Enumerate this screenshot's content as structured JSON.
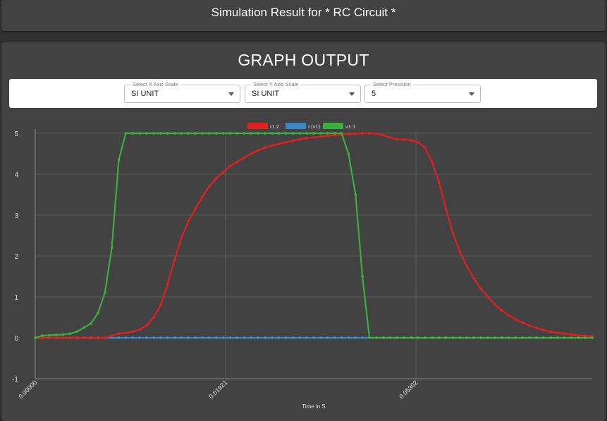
{
  "header": {
    "title": "Simulation Result for * RC Circuit *"
  },
  "graph": {
    "heading": "GRAPH OUTPUT",
    "controls": [
      {
        "label": "Select X Axis Scale",
        "value": "SI UNIT"
      },
      {
        "label": "Select Y Axis Scale",
        "value": "SI UNIT"
      },
      {
        "label": "Select Precision",
        "value": "5"
      }
    ]
  },
  "chart_data": {
    "type": "line",
    "xlabel": "Time in S",
    "ylabel": "",
    "x_tick_labels": [
      "0.00000",
      "0.01921",
      "0.05302"
    ],
    "y_ticks": [
      -1,
      0,
      1,
      2,
      3,
      4,
      5
    ],
    "ylim": [
      -1,
      5
    ],
    "legend_position": "top-center",
    "grid": true,
    "series": [
      {
        "name": "r1.2",
        "color": "#e02020",
        "values": [
          0,
          0,
          0,
          0,
          0,
          0,
          0,
          0,
          0,
          0,
          0,
          0.05,
          0.1,
          0.12,
          0.15,
          0.2,
          0.3,
          0.5,
          0.8,
          1.3,
          1.9,
          2.45,
          2.85,
          3.15,
          3.45,
          3.7,
          3.9,
          4.05,
          4.2,
          4.3,
          4.4,
          4.5,
          4.58,
          4.65,
          4.7,
          4.74,
          4.78,
          4.82,
          4.85,
          4.88,
          4.9,
          4.92,
          4.94,
          4.95,
          4.97,
          4.98,
          4.99,
          5.0,
          5.0,
          4.99,
          4.95,
          4.9,
          4.85,
          4.85,
          4.83,
          4.78,
          4.65,
          4.3,
          3.8,
          3.15,
          2.55,
          2.1,
          1.75,
          1.45,
          1.2,
          1.0,
          0.82,
          0.67,
          0.55,
          0.45,
          0.37,
          0.3,
          0.24,
          0.19,
          0.15,
          0.12,
          0.1,
          0.08,
          0.06,
          0.05,
          0.04
        ]
      },
      {
        "name": "I (v1)",
        "color": "#3d86c6",
        "values": [
          0,
          0,
          0,
          0,
          0,
          0,
          0,
          0,
          0,
          0,
          0,
          0,
          0,
          0,
          0,
          0,
          0,
          0,
          0,
          0,
          0,
          0,
          0,
          0,
          0,
          0,
          0,
          0,
          0,
          0,
          0,
          0,
          0,
          0,
          0,
          0,
          0,
          0,
          0,
          0,
          0,
          0,
          0,
          0,
          0,
          0,
          0,
          0,
          0,
          0,
          0,
          0,
          0,
          0,
          0,
          0,
          0,
          0,
          0,
          0,
          0,
          0,
          0,
          0,
          0,
          0,
          0,
          0,
          0,
          0,
          0,
          0,
          0,
          0,
          0,
          0,
          0,
          0,
          0,
          0,
          0
        ]
      },
      {
        "name": "v1.1",
        "color": "#3cae3c",
        "values": [
          0,
          0.05,
          0.06,
          0.07,
          0.08,
          0.1,
          0.15,
          0.25,
          0.35,
          0.6,
          1.1,
          2.2,
          4.35,
          5,
          5,
          5,
          5,
          5,
          5,
          5,
          5,
          5,
          5,
          5,
          5,
          5,
          5,
          5,
          5,
          5,
          5,
          5,
          5,
          5,
          5,
          5,
          5,
          5,
          5,
          5,
          5,
          5,
          5,
          5,
          5,
          4.5,
          3.5,
          1.5,
          0,
          0,
          0,
          0,
          0,
          0,
          0,
          0,
          0,
          0,
          0,
          0,
          0,
          0,
          0,
          0,
          0,
          0,
          0,
          0,
          0,
          0,
          0,
          0,
          0,
          0,
          0,
          0,
          0,
          0,
          0,
          0,
          0
        ]
      }
    ]
  }
}
